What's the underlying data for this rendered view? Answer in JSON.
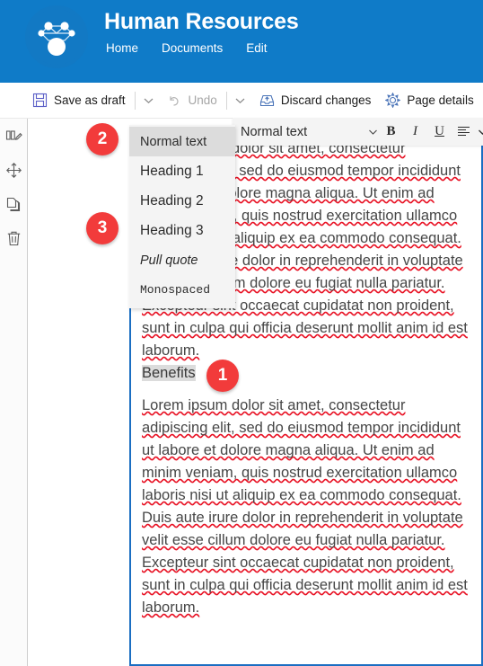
{
  "header": {
    "title": "Human Resources",
    "logo_icon": "network-nodes-logo",
    "nav": [
      {
        "label": "Home",
        "name": "nav-home"
      },
      {
        "label": "Documents",
        "name": "nav-documents"
      },
      {
        "label": "Edit",
        "name": "nav-edit"
      }
    ],
    "brand_color": "#0f7bc8"
  },
  "command_bar": {
    "save": {
      "label": "Save as draft",
      "icon": "save-floppy-icon"
    },
    "save_chevron": "chevron-down-icon",
    "undo": {
      "label": "Undo",
      "icon": "undo-arrow-icon",
      "disabled": true
    },
    "undo_chevron": "chevron-down-icon",
    "discard": {
      "label": "Discard changes",
      "icon": "discard-tray-icon"
    },
    "page_details": {
      "label": "Page details",
      "icon": "gear-icon"
    }
  },
  "rail": {
    "items": [
      {
        "name": "edit-section-icon",
        "title": "Edit section"
      },
      {
        "name": "move-icon",
        "title": "Move"
      },
      {
        "name": "duplicate-icon",
        "title": "Duplicate"
      },
      {
        "name": "delete-icon",
        "title": "Delete"
      }
    ]
  },
  "format_bar": {
    "style_value": "Normal text",
    "style_caret": "chevron-down-icon",
    "bold": "B",
    "italic": "I",
    "underline": "U",
    "align_icon": "align-left-icon",
    "align_caret": "chevron-down-icon",
    "list_icon": "bullet-list-icon",
    "list_caret": "chevron-down-icon",
    "link_icon": "link-chain-icon"
  },
  "style_dropdown": {
    "options": [
      {
        "label": "Normal text",
        "selected": true
      },
      {
        "label": "Heading 1",
        "selected": false
      },
      {
        "label": "Heading 2",
        "selected": false
      },
      {
        "label": "Heading 3",
        "selected": false
      },
      {
        "label": "Pull quote",
        "selected": false
      },
      {
        "label": "Monospaced",
        "selected": false
      }
    ]
  },
  "content": {
    "heading": "Benefits",
    "paragraph_visible_lines": [
      "labore et dolore magna aliqua.",
      "inim veniam, quis nostrud",
      "llamco laboris nisi ut aliquip ex",
      "consequat. Duis aute irure dolor",
      "erit in voluptate velit esse cillum",
      "iat nulla pariatur. Excepteur sint",
      "datat non proident, sunt in culpa",
      "serunt mollit anim id est",
      "laborum."
    ],
    "paragraph": "Lorem ipsum dolor sit amet, consectetur adipiscing elit, sed do eiusmod tempor incididunt ut labore et dolore magna aliqua. Ut enim ad minim veniam, quis nostrud exercitation ullamco laboris nisi ut aliquip ex ea commodo consequat. Duis aute irure dolor in reprehenderit in voluptate velit esse cillum dolore eu fugiat nulla pariatur. Excepteur sint occaecat cupidatat non proident, sunt in culpa qui officia deserunt mollit anim id est laborum.",
    "selection_border_color": "#1b6ec2"
  },
  "callouts": [
    {
      "number": "1"
    },
    {
      "number": "2"
    },
    {
      "number": "3"
    }
  ]
}
